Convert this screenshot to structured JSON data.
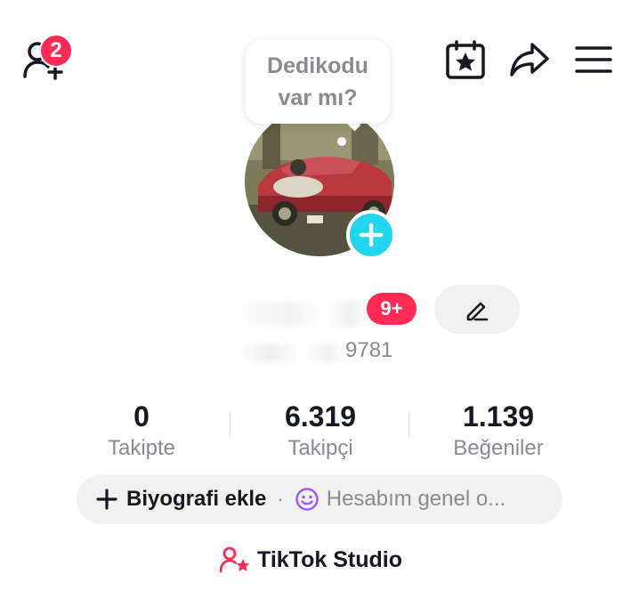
{
  "header": {
    "notification_count": "2",
    "icons": [
      "add-friend-icon",
      "calendar-star-icon",
      "share-icon",
      "menu-icon"
    ]
  },
  "note": {
    "text": "Dedikodu var mı?"
  },
  "profile": {
    "new_count_badge": "9+",
    "handle_visible_suffix": "9781"
  },
  "stats": [
    {
      "value": "0",
      "label": "Takipte"
    },
    {
      "value": "6.319",
      "label": "Takipçi"
    },
    {
      "value": "1.139",
      "label": "Beğeniler"
    }
  ],
  "bio": {
    "add_label": "Biyografi ekle",
    "separator": "·",
    "status_text": "Hesabım genel o..."
  },
  "studio": {
    "label": "TikTok Studio"
  },
  "colors": {
    "accent": "#fe2c55",
    "avatar_plus": "#20d5ec",
    "status_icon": "#a259ff",
    "muted_text": "#8a8b91"
  }
}
